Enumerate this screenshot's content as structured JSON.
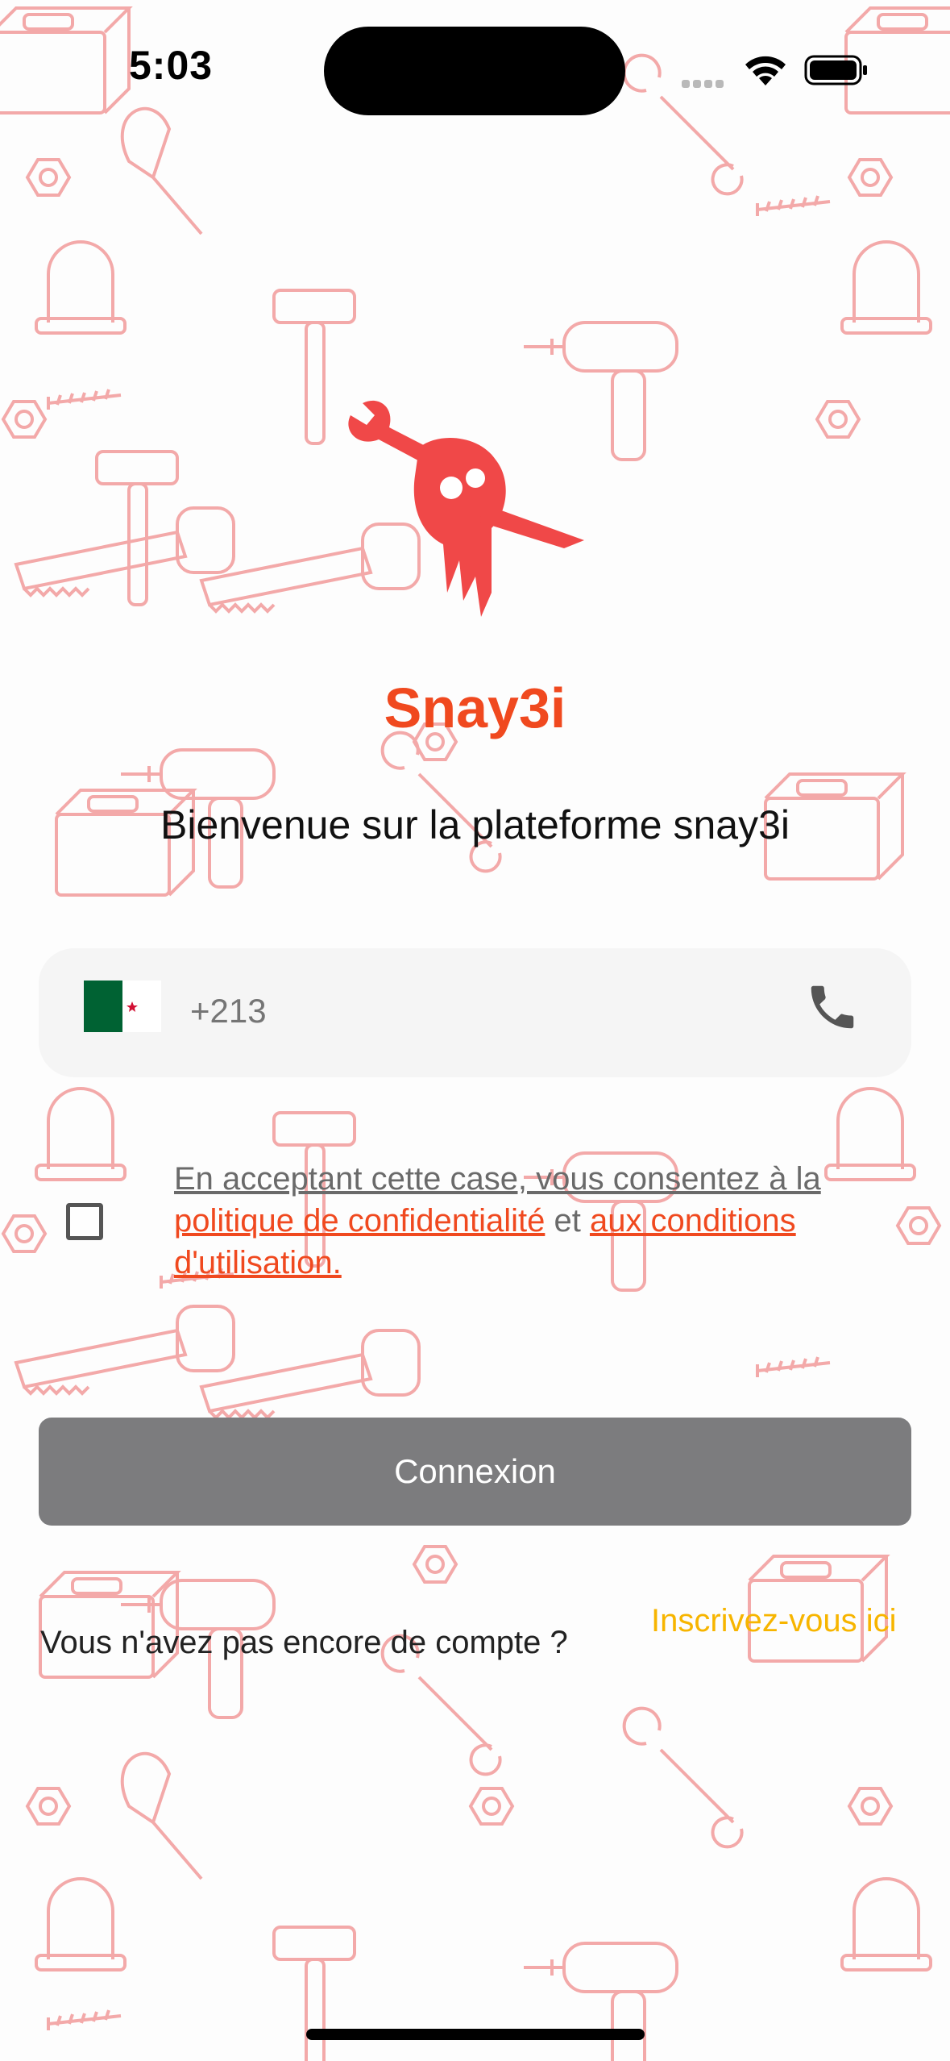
{
  "status_bar": {
    "time": "5:03",
    "icons": [
      "cellular-signal-icon",
      "wifi-icon",
      "battery-icon"
    ]
  },
  "brand": {
    "app_name": "Snay3i",
    "logo_icon": "fist-holding-wrench-and-pencil-logo",
    "accent_color": "#f0491f"
  },
  "welcome_text": "Bienvenue sur la plateforme snay3i",
  "phone_field": {
    "country_flag": "algeria-flag-icon",
    "prefix": "+213",
    "trailing_icon": "phone-icon"
  },
  "consent": {
    "checked": false,
    "lead": "En acceptant cette case, vous consentez à la",
    "privacy_link": "politique de confidentialité",
    "conjunction": "et",
    "terms_link": "aux conditions d'utilisation."
  },
  "login_button": {
    "label": "Connexion",
    "color": "#7c7c7e"
  },
  "signup": {
    "prompt": "Vous n'avez pas encore de compte ?",
    "link": "Inscrivez-vous ici",
    "link_color": "#f7b500"
  },
  "background": {
    "pattern": "tools-line-art-pattern",
    "color": "#f2a8a8"
  }
}
